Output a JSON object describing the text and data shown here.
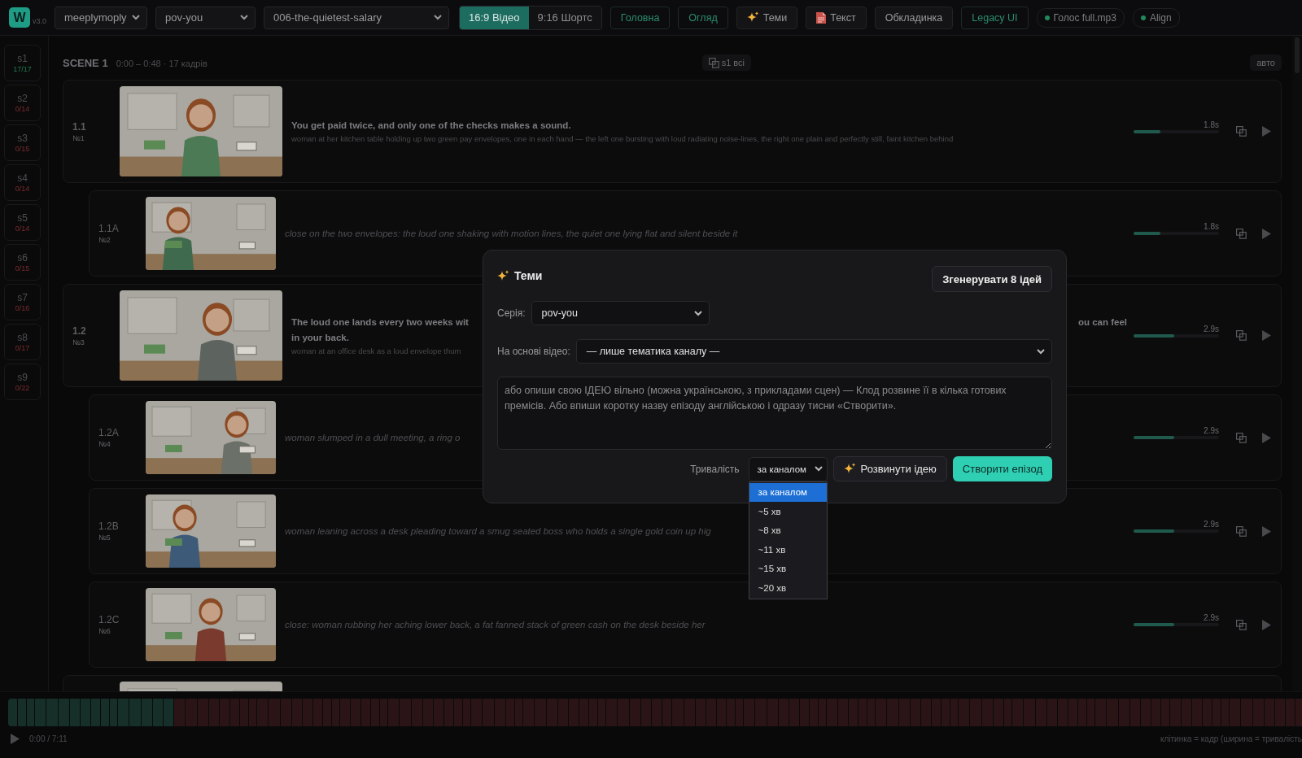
{
  "app": {
    "logo": "W",
    "version": "v3.0"
  },
  "toolbar": {
    "selects": [
      {
        "value": "meeplymoply"
      },
      {
        "value": "pov-you"
      },
      {
        "value": "006-the-quietest-salary"
      }
    ],
    "format_tabs": [
      {
        "label": "16:9 Відео",
        "selected": true
      },
      {
        "label": "9:16 Шортс",
        "selected": false
      }
    ],
    "nav": [
      {
        "label": "Головна",
        "kind": "link"
      },
      {
        "label": "Огляд",
        "kind": "link"
      },
      {
        "label": "Теми",
        "kind": "button"
      },
      {
        "label": "Текст",
        "kind": "button"
      },
      {
        "label": "Обкладинка",
        "kind": "button"
      },
      {
        "label": "Legacy UI",
        "kind": "link"
      }
    ],
    "status_pills": [
      {
        "label": "Голос full.mp3",
        "color": "#1f8a5a"
      },
      {
        "label": "Align",
        "color": "#1f8a5a"
      }
    ]
  },
  "sidebar": {
    "scenes": [
      {
        "label": "s1",
        "count": "17/17",
        "complete": true
      },
      {
        "label": "s2",
        "count": "0/14",
        "complete": false
      },
      {
        "label": "s3",
        "count": "0/15",
        "complete": false
      },
      {
        "label": "s4",
        "count": "0/14",
        "complete": false
      },
      {
        "label": "s5",
        "count": "0/14",
        "complete": false
      },
      {
        "label": "s6",
        "count": "0/15",
        "complete": false
      },
      {
        "label": "s7",
        "count": "0/16",
        "complete": false
      },
      {
        "label": "s8",
        "count": "0/17",
        "complete": false
      },
      {
        "label": "s9",
        "count": "0/22",
        "complete": false
      }
    ]
  },
  "scene": {
    "title": "SCENE 1",
    "meta": "0:00 – 0:48 · 17 кадрів",
    "copy_button": "s1 всі",
    "mode": "авто"
  },
  "frames": [
    {
      "kind": "main",
      "id": "1.1",
      "number": "№1",
      "title": "You get paid twice, and only one of the checks makes a sound.",
      "description": "woman at her kitchen table holding up two green pay envelopes, one in each hand — the left one bursting with loud radiating noise-lines, the right one plain and perfectly still, faint kitchen behind",
      "level": 0.31,
      "duration": "1.8s"
    },
    {
      "kind": "sub",
      "id": "1.1A",
      "number": "№2",
      "description": "close on the two envelopes: the loud one shaking with motion lines, the quiet one lying flat and silent beside it",
      "level": 0.31,
      "duration": "1.8s"
    },
    {
      "kind": "main",
      "id": "1.2",
      "number": "№3",
      "title": "The loud one lands every two weeks wit",
      "title_right": "ou can feel",
      "title_continued": "in your back.",
      "description": "woman at an office desk as a loud envelope thum",
      "level": 0.48,
      "duration": "2.9s"
    },
    {
      "kind": "sub",
      "id": "1.2A",
      "number": "№4",
      "description": "woman slumped in a dull meeting, a ring o",
      "level": 0.48,
      "duration": "2.9s"
    },
    {
      "kind": "sub",
      "id": "1.2B",
      "number": "№5",
      "description": "woman leaning across a desk pleading toward a smug seated boss who holds a single gold coin up hig",
      "level": 0.48,
      "duration": "2.9s"
    },
    {
      "kind": "sub",
      "id": "1.2C",
      "number": "№6",
      "description": "close: woman rubbing her aching lower back, a fat fanned stack of green cash on the desk beside her",
      "level": 0.48,
      "duration": "2.9s"
    },
    {
      "kind": "partial"
    }
  ],
  "modal": {
    "title": "Теми",
    "generate_button": "Згенерувати 8 ідей",
    "series": {
      "label": "Серія:",
      "value": "pov-you"
    },
    "source": {
      "label": "На основі відео:",
      "value": "— лише тематика каналу —"
    },
    "idea": {
      "placeholder": "або опиши свою ІДЕЮ вільно (можна українською, з прикладами сцен) — Клод розвине її в кілька готових премісів. Або впиши коротку назву епізоду англійською і одразу тисни «Створити»."
    },
    "duration": {
      "label": "Тривалість",
      "value": "за каналом",
      "expanded": true,
      "options": [
        {
          "label": "за каналом",
          "selected": true
        },
        {
          "label": "~5 хв",
          "selected": false
        },
        {
          "label": "~8 хв",
          "selected": false
        },
        {
          "label": "~11 хв",
          "selected": false
        },
        {
          "label": "~15 хв",
          "selected": false
        },
        {
          "label": "~20 хв",
          "selected": false
        }
      ]
    },
    "develop_button": "Розвинути ідею",
    "create_button": "Створити епізод"
  },
  "player": {
    "time": "0:00 / 7:11",
    "legend": "клітинка = кадр (ширина = тривалість"
  }
}
